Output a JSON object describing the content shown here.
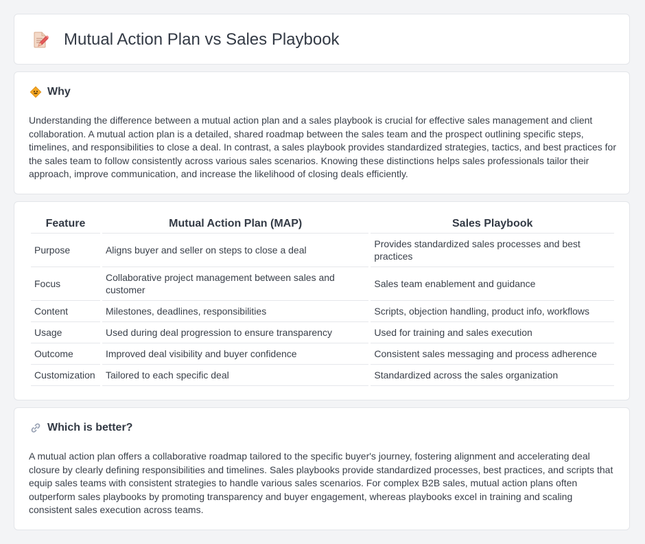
{
  "header": {
    "title": "Mutual Action Plan vs Sales Playbook",
    "icon": "document-pencil-icon"
  },
  "why": {
    "icon": "diamond-warning-icon",
    "title": "Why",
    "text": "Understanding the difference between a mutual action plan and a sales playbook is crucial for effective sales management and client collaboration. A mutual action plan is a detailed, shared roadmap between the sales team and the prospect outlining specific steps, timelines, and responsibilities to close a deal. In contrast, a sales playbook provides standardized strategies, tactics, and best practices for the sales team to follow consistently across various sales scenarios. Knowing these distinctions helps sales professionals tailor their approach, improve communication, and increase the likelihood of closing deals efficiently."
  },
  "comparison": {
    "headers": [
      "Feature",
      "Mutual Action Plan (MAP)",
      "Sales Playbook"
    ],
    "rows": [
      [
        "Purpose",
        "Aligns buyer and seller on steps to close a deal",
        "Provides standardized sales processes and best practices"
      ],
      [
        "Focus",
        "Collaborative project management between sales and customer",
        "Sales team enablement and guidance"
      ],
      [
        "Content",
        "Milestones, deadlines, responsibilities",
        "Scripts, objection handling, product info, workflows"
      ],
      [
        "Usage",
        "Used during deal progression to ensure transparency",
        "Used for training and sales execution"
      ],
      [
        "Outcome",
        "Improved deal visibility and buyer confidence",
        "Consistent sales messaging and process adherence"
      ],
      [
        "Customization",
        "Tailored to each specific deal",
        "Standardized across the sales organization"
      ]
    ]
  },
  "better": {
    "icon": "link-icon",
    "title": "Which is better?",
    "text": "A mutual action plan offers a collaborative roadmap tailored to the specific buyer's journey, fostering alignment and accelerating deal closure by clearly defining responsibilities and timelines. Sales playbooks provide standardized processes, best practices, and scripts that equip sales teams with consistent strategies to handle various sales scenarios. For complex B2B sales, mutual action plans often outperform sales playbooks by promoting transparency and buyer engagement, whereas playbooks excel in training and scaling consistent sales execution across teams."
  },
  "colors": {
    "background": "#f3f4f6",
    "card": "#ffffff",
    "border": "#e3e5e9",
    "text": "#3a404a",
    "icon_orange": "#f5a623",
    "icon_pink": "#e97979"
  }
}
